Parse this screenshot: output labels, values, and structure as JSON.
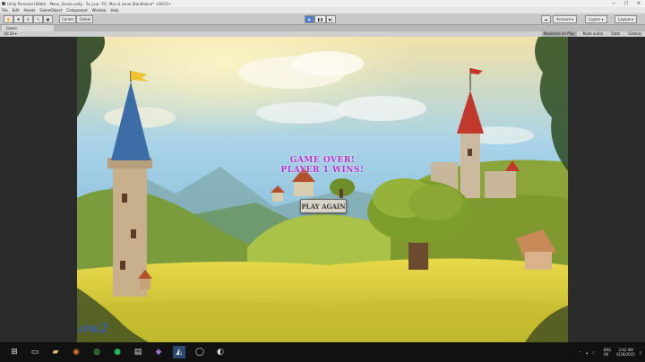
{
  "window": {
    "title": "Unity Personal (64bit) - Menu_Scene.unity - 5x_Lua - PC, Mac & Linux Standalone* <DX11>",
    "controls": [
      "—",
      "☐",
      "✕"
    ]
  },
  "menu": [
    "File",
    "Edit",
    "Assets",
    "GameObject",
    "Component",
    "Window",
    "Help"
  ],
  "toolbar": {
    "pivot": "Center",
    "space": "Global",
    "account": "Account",
    "layers": "Layers",
    "layout": "Layout"
  },
  "game_tab": {
    "label": "Game",
    "aspect": "16:10",
    "maximize": "Maximize on Play",
    "mute": "Mute audio",
    "stats": "Stats",
    "gizmos": "Gizmos"
  },
  "game": {
    "line1": "GAME OVER!",
    "line2": "PLAYER 1 WINS!",
    "play_again": "PLAY AGAIN",
    "logo_fragment": "ow2"
  },
  "taskbar": {
    "lang": "ENG",
    "region": "UK",
    "time": "3:42 AM",
    "date": "6/18/2015"
  }
}
